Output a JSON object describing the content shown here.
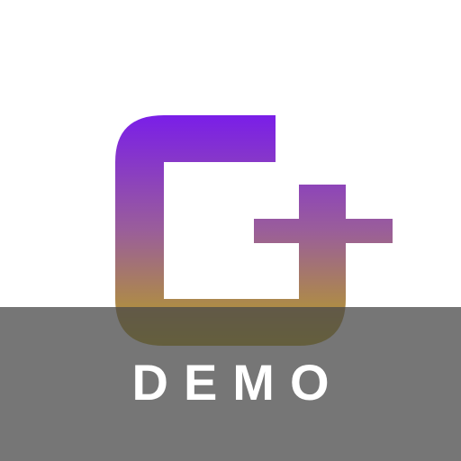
{
  "logo": {
    "icon": "g-plus-logo-icon",
    "gradient_top_color": "#7a1ee8",
    "gradient_bottom_color": "#b8a21c"
  },
  "banner": {
    "label": "DEMO",
    "text_color": "#ffffff",
    "overlay_color": "#484848"
  }
}
